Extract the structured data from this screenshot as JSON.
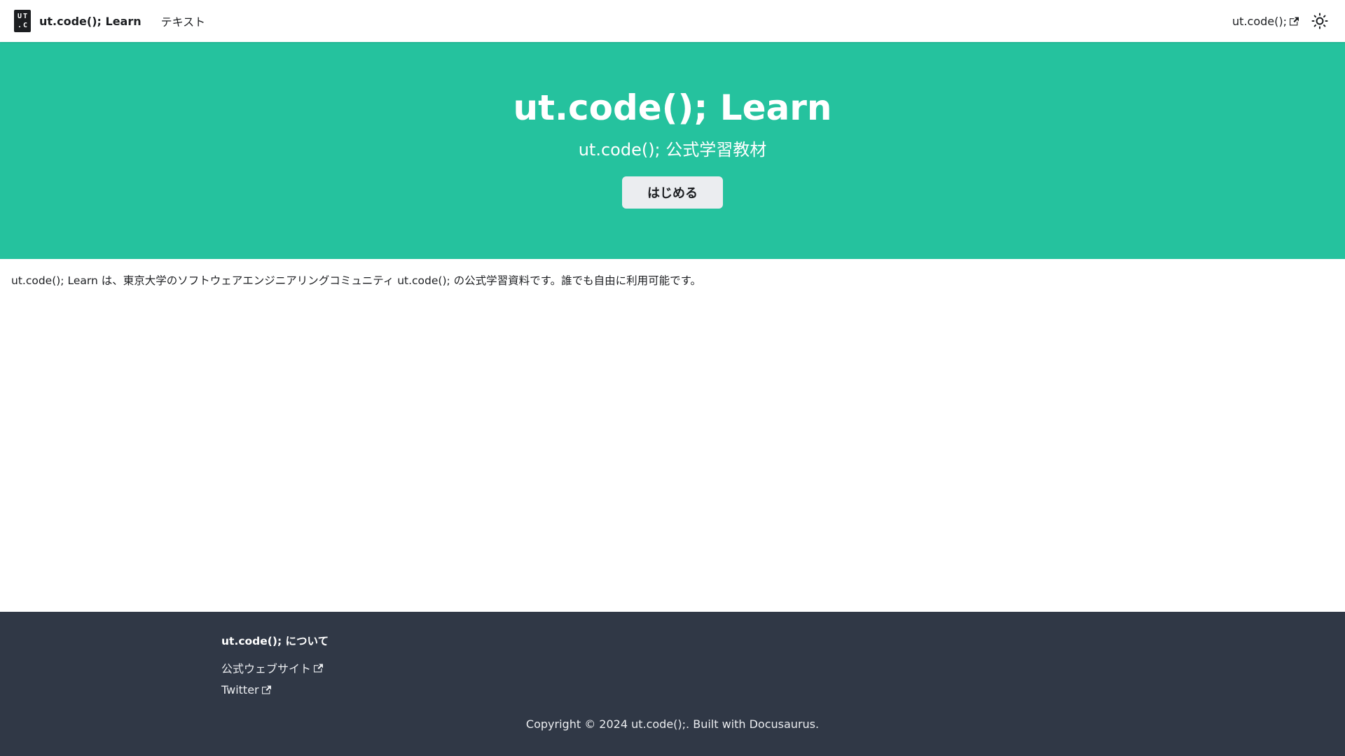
{
  "navbar": {
    "logo_text_top": "UT",
    "logo_text_bottom": ".C",
    "brand_title": "ut.code(); Learn",
    "nav_text_label": "テキスト",
    "external_link_label": "ut.code();",
    "theme_icon": "sun-icon"
  },
  "hero": {
    "title": "ut.code(); Learn",
    "subtitle": "ut.code(); 公式学習教材",
    "start_button_label": "はじめる",
    "background_color": "#25c29e"
  },
  "main": {
    "intro_text": "ut.code(); Learn は、東京大学のソフトウェアエンジニアリングコミュニティ ut.code(); の公式学習資料です。誰でも自由に利用可能です。"
  },
  "footer": {
    "heading": "ut.code(); について",
    "links": [
      {
        "label": "公式ウェブサイト",
        "icon": "external-link-icon"
      },
      {
        "label": "Twitter",
        "icon": "external-link-icon"
      }
    ],
    "copyright": "Copyright © 2024 ut.code();. Built with Docusaurus.",
    "background_color": "#303846"
  }
}
